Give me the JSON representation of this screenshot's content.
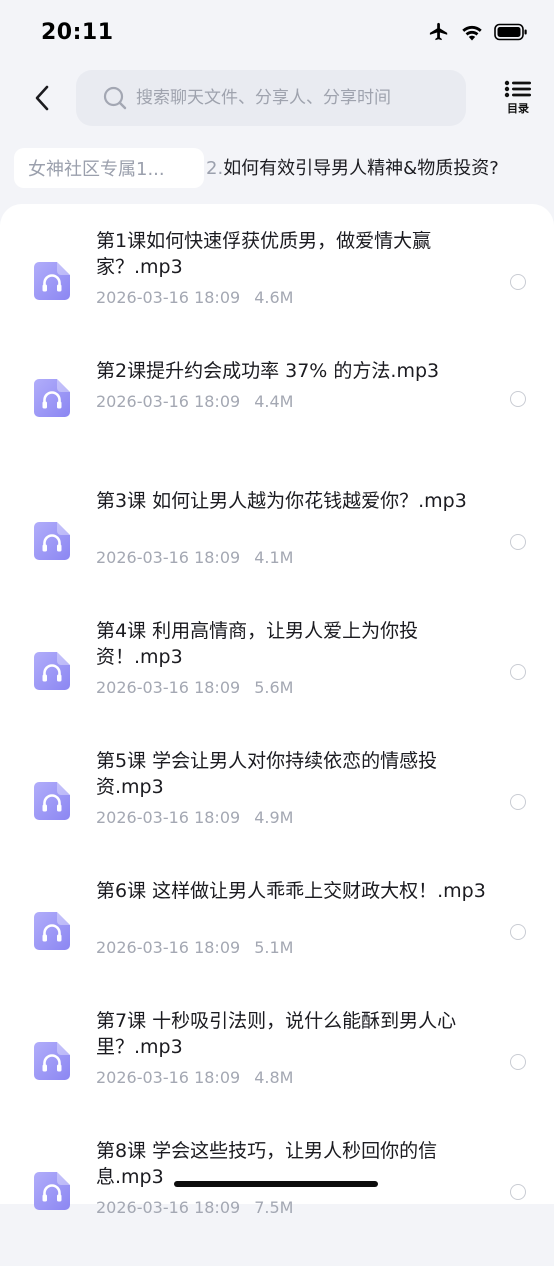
{
  "status": {
    "time": "20:11",
    "icons": [
      "airplane-icon",
      "wifi-icon",
      "battery-icon"
    ]
  },
  "header": {
    "back_icon": "chevron-left-icon",
    "search_placeholder": "搜索聊天文件、分享人、分享时间",
    "toc_label": "目录"
  },
  "breadcrumb": {
    "group": "女神社区专属1...",
    "title_prefix": "2.",
    "title": "如何有效引导男人精神&物质投资?"
  },
  "colors": {
    "accent": "#8b86f2",
    "accent_light": "#b1adfa",
    "meta": "#a4a8b3"
  },
  "files": [
    {
      "name": "第1课如何快速俘获优质男，做爱情大赢家？.mp3",
      "date": "2026-03-16 18:09",
      "size": "4.6M"
    },
    {
      "name": "第2课提升约会成功率 37% 的方法.mp3",
      "date": "2026-03-16 18:09",
      "size": "4.4M"
    },
    {
      "name": "第3课 如何让男人越为你花钱越爱你？.mp3",
      "date": "2026-03-16 18:09",
      "size": "4.1M"
    },
    {
      "name": "第4课 利用高情商，让男人爱上为你投资！.mp3",
      "date": "2026-03-16 18:09",
      "size": "5.6M"
    },
    {
      "name": "第5课 学会让男人对你持续依恋的情感投资.mp3",
      "date": "2026-03-16 18:09",
      "size": "4.9M"
    },
    {
      "name": "第6课 这样做让男人乖乖上交财政大权！.mp3",
      "date": "2026-03-16 18:09",
      "size": "5.1M"
    },
    {
      "name": "第7课 十秒吸引法则，说什么能酥到男人心里？.mp3",
      "date": "2026-03-16 18:09",
      "size": "4.8M"
    },
    {
      "name": "第8课 学会这些技巧，让男人秒回你的信息.mp3",
      "date": "2026-03-16 18:09",
      "size": "7.5M"
    }
  ]
}
